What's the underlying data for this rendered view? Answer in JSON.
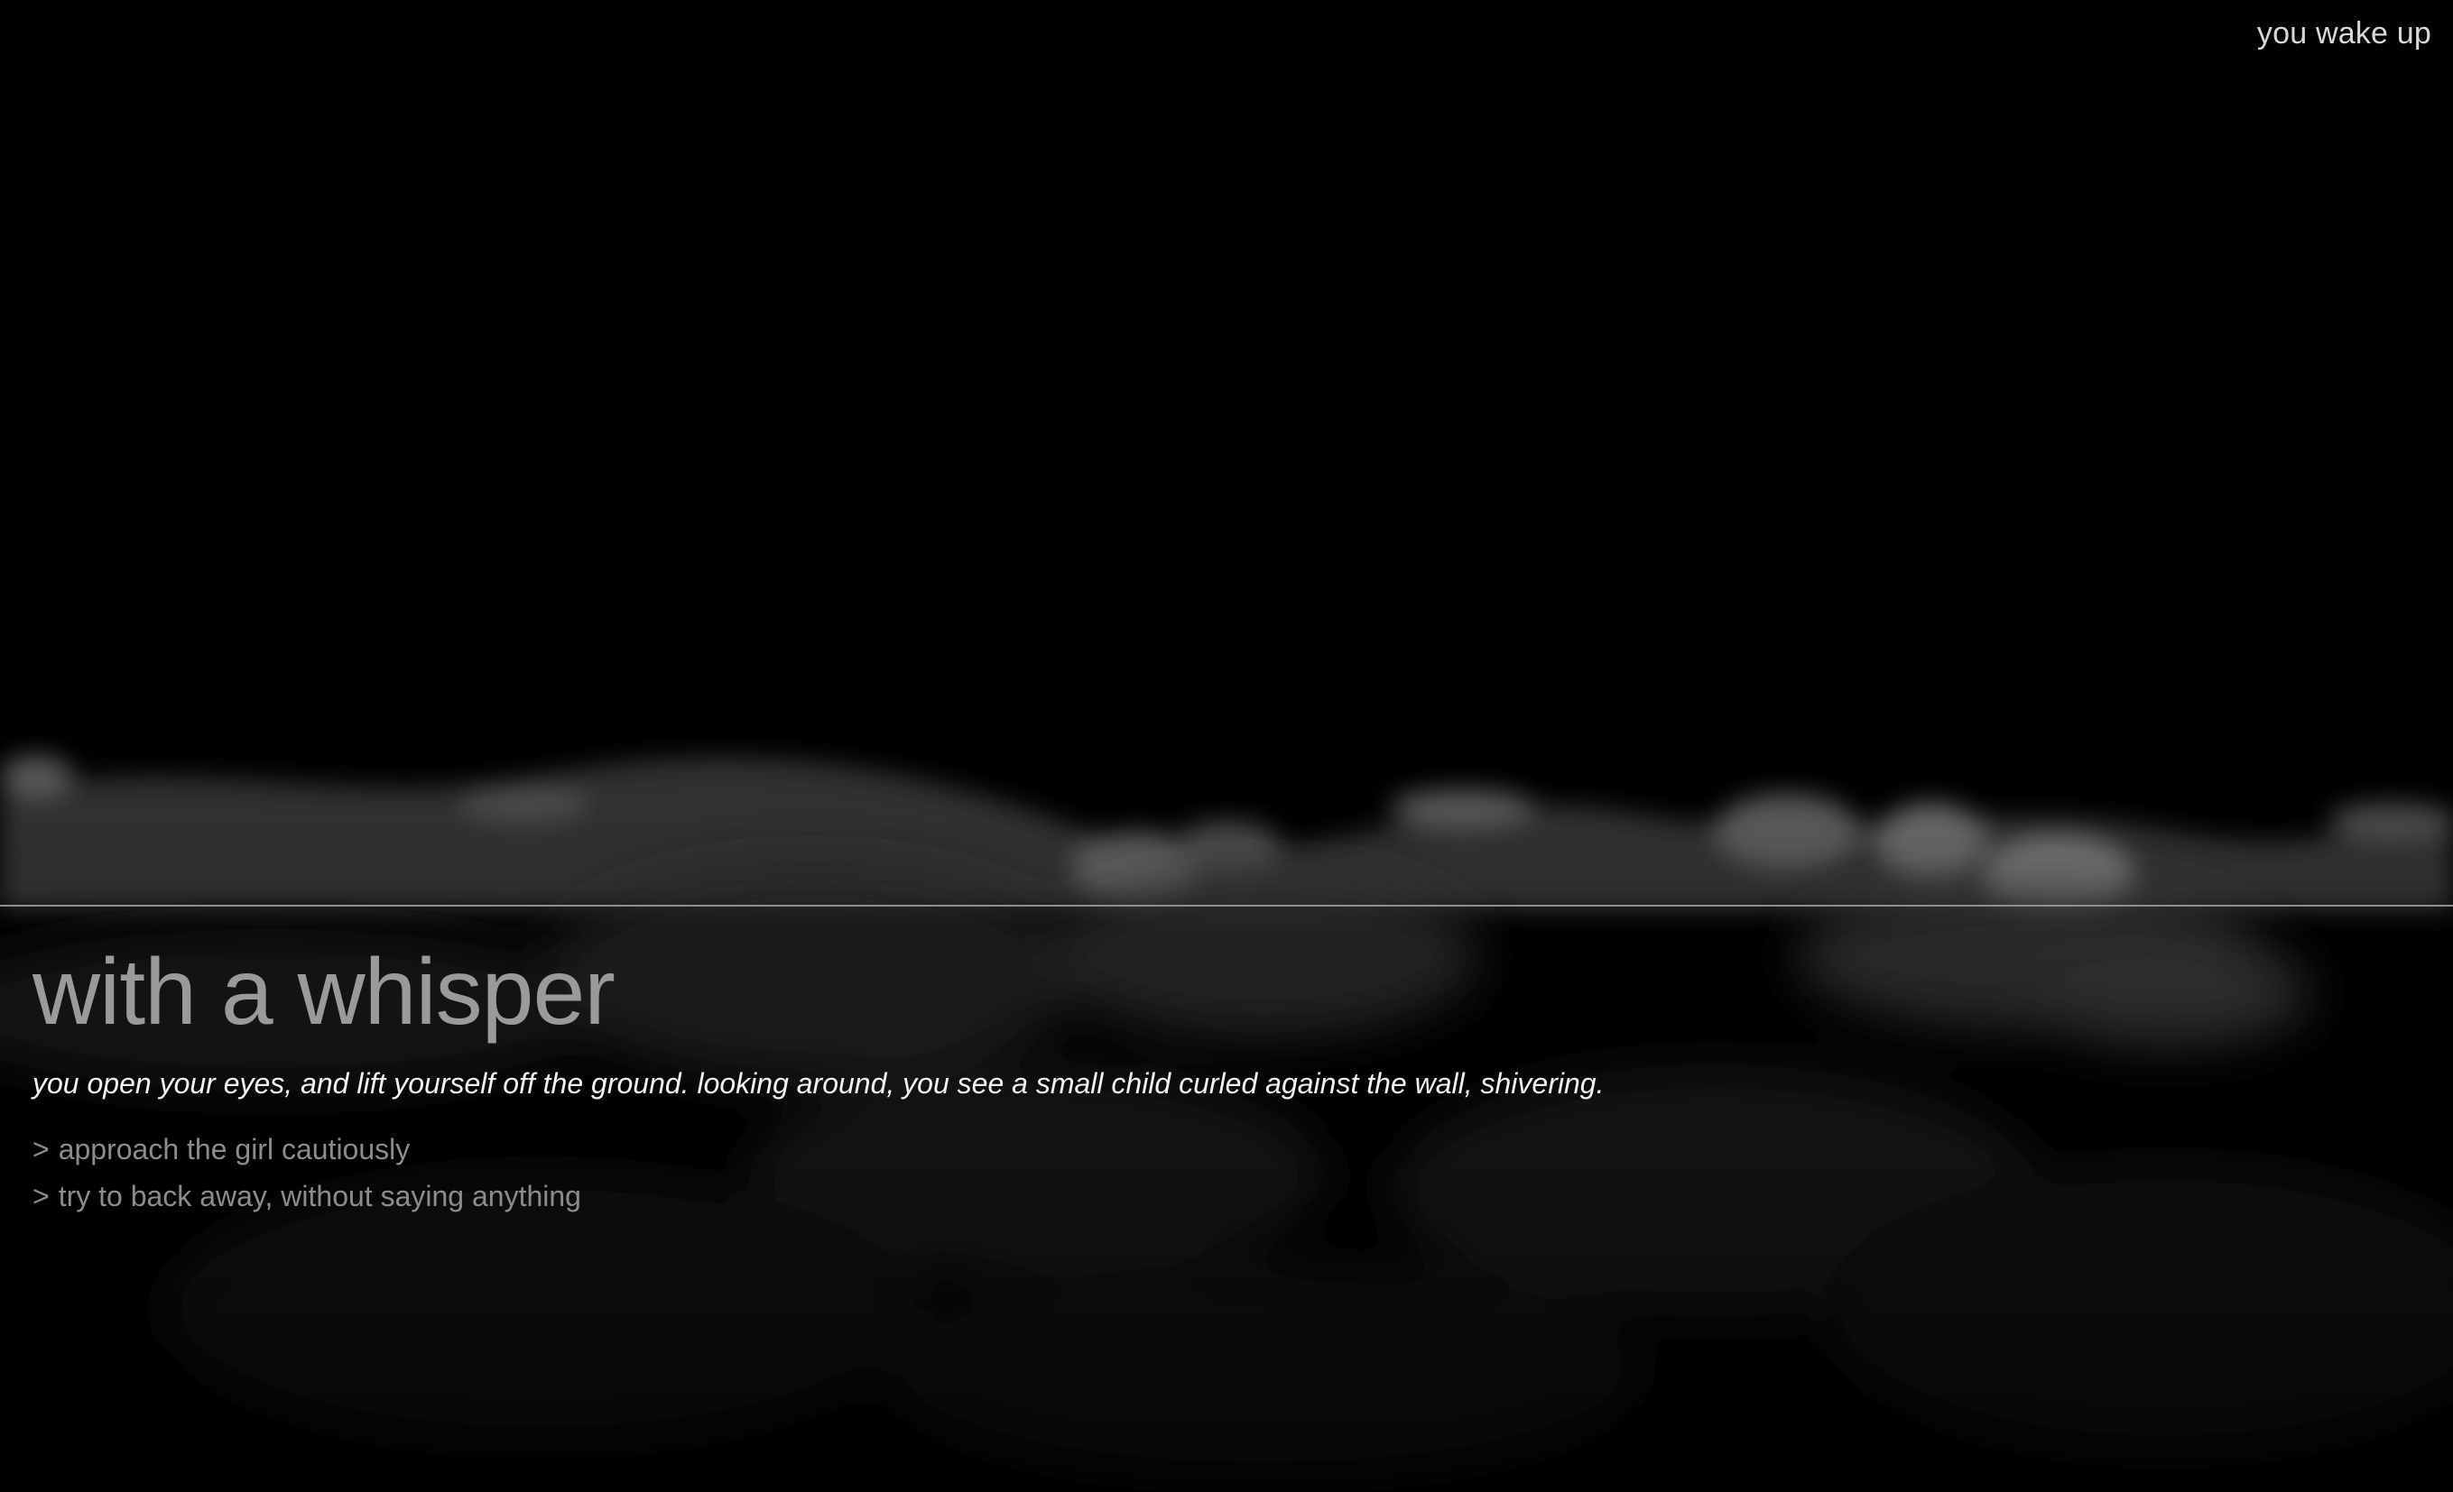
{
  "header": {
    "chapter_label": "you wake up"
  },
  "story": {
    "title": "with a whisper",
    "text": "you open your eyes, and lift yourself off the ground. looking around, you see a small child curled against the wall, shivering.",
    "choices": [
      {
        "marker": ">",
        "label": "approach the girl cautiously"
      },
      {
        "marker": ">",
        "label": "try to back away, without saying anything"
      }
    ]
  },
  "colors": {
    "background": "#000000",
    "divider": "#8f8f8f",
    "title": "#9a9a9a",
    "text": "#f2f2f2",
    "choice": "#8c8c8c"
  }
}
